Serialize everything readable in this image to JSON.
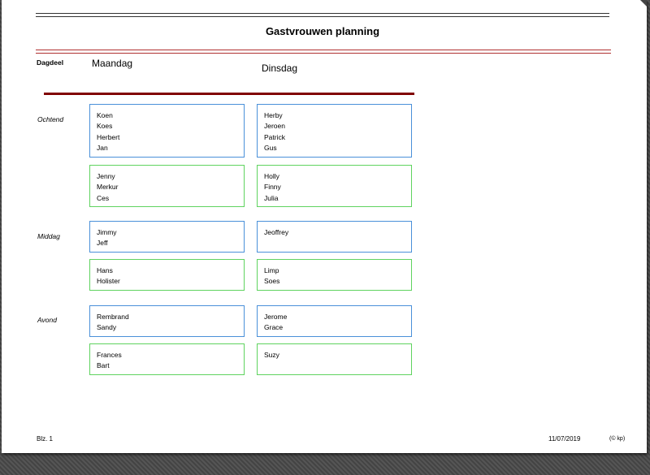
{
  "header": {
    "title": "Gastvrouwen planning"
  },
  "columns": {
    "row_label_header": "Dagdeel",
    "days": [
      "Maandag",
      "Dinsdag"
    ]
  },
  "slots": [
    {
      "label": "Ochtend",
      "cells": [
        [
          [
            "Koen",
            "Koes",
            "Herbert",
            "Jan"
          ],
          [
            "Jenny",
            "Merkur",
            "Ces"
          ]
        ],
        [
          [
            "Herby",
            "Jeroen",
            "Patrick",
            "Gus"
          ],
          [
            "Holly",
            "Finny",
            "Julia"
          ]
        ]
      ]
    },
    {
      "label": "Middag",
      "cells": [
        [
          [
            "Jimmy",
            "Jeff"
          ],
          [
            "Hans",
            "Holister"
          ]
        ],
        [
          [
            "Jeoffrey"
          ],
          [
            "Limp",
            "Soes"
          ]
        ]
      ]
    },
    {
      "label": "Avond",
      "cells": [
        [
          [
            "Rembrand",
            "Sandy"
          ],
          [
            "Frances",
            "Bart"
          ]
        ],
        [
          [
            "Jerome",
            "Grace"
          ],
          [
            "Suzy"
          ]
        ]
      ]
    }
  ],
  "footer": {
    "page": "Blz. 1",
    "date": "11/07/2019",
    "copyright": "(© kp)"
  },
  "colors": {
    "header_rule_dark": "#333333",
    "header_rule_red": "#b03030",
    "day_divider": "#800000",
    "box_blue": "#4a90d9",
    "box_green": "#5fd35f"
  }
}
